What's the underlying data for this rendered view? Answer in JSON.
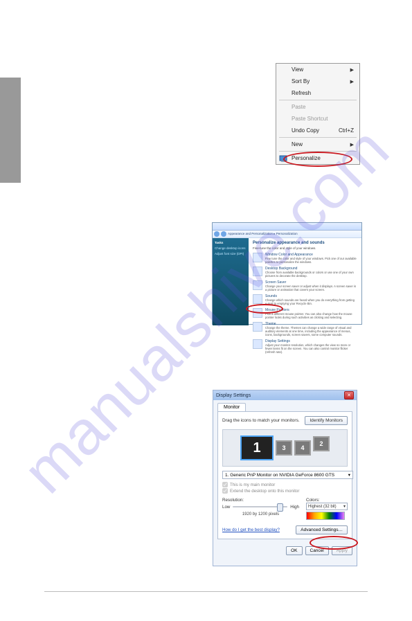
{
  "watermark": "manualshive.com",
  "context_menu": {
    "items": [
      {
        "label": "View",
        "submenu": true,
        "disabled": false,
        "name": "ctx-view"
      },
      {
        "label": "Sort By",
        "submenu": true,
        "disabled": false,
        "name": "ctx-sort-by"
      },
      {
        "label": "Refresh",
        "submenu": false,
        "disabled": false,
        "name": "ctx-refresh"
      }
    ],
    "items2": [
      {
        "label": "Paste",
        "submenu": false,
        "disabled": true,
        "name": "ctx-paste"
      },
      {
        "label": "Paste Shortcut",
        "submenu": false,
        "disabled": true,
        "name": "ctx-paste-shortcut"
      },
      {
        "label": "Undo Copy",
        "shortcut": "Ctrl+Z",
        "submenu": false,
        "disabled": false,
        "name": "ctx-undo-copy"
      }
    ],
    "items3": [
      {
        "label": "New",
        "submenu": true,
        "disabled": false,
        "name": "ctx-new"
      }
    ],
    "items4": [
      {
        "label": "Personalize",
        "submenu": false,
        "disabled": false,
        "name": "ctx-personalize",
        "icon": true
      }
    ]
  },
  "personalize_window": {
    "breadcrumb": "Appearance and Personalization  ▸  Personalization",
    "side_head": "Tasks",
    "side_items": [
      "Change desktop icons",
      "Adjust font size (DPI)"
    ],
    "main_title": "Personalize appearance and sounds",
    "main_sub": "Fine-tune the color and style of your windows.",
    "items": [
      {
        "link": "Window Color and Appearance",
        "txt": "Fine tune the color and style of your windows. Pick one of our available palettes to personalize the windows."
      },
      {
        "link": "Desktop Background",
        "txt": "Choose from available backgrounds or colors or use one of your own pictures to decorate the desktop."
      },
      {
        "link": "Screen Saver",
        "txt": "Change your screen saver or adjust when it displays. A screen saver is a picture or animation that covers your screen."
      },
      {
        "link": "Sounds",
        "txt": "Change which sounds are heard when you do everything from getting e-mail to emptying your Recycle Bin."
      },
      {
        "link": "Mouse Pointers",
        "txt": "Pick a different mouse pointer. You can also change how the mouse pointer looks during such activities as clicking and selecting."
      },
      {
        "link": "Theme",
        "txt": "Change the theme. Themes can change a wide range of visual and auditory elements at one time, including the appearance of menus, icons, backgrounds, screen savers, some computer sounds."
      },
      {
        "link": "Display Settings",
        "txt": "Adjust your monitor resolution, which changes the view so more or fewer items fit on the screen. You can also control monitor flicker (refresh rate)."
      }
    ]
  },
  "display_settings": {
    "title": "Display Settings",
    "tab": "Monitor",
    "drag_label": "Drag the icons to match your monitors.",
    "identify_btn": "Identify Monitors",
    "monitors": [
      "1",
      "3",
      "4",
      "2"
    ],
    "selected_monitor": "1. Generic PnP Monitor on NVIDIA GeForce 8600 GTS",
    "check1": "This is my main monitor",
    "check2": "Extend the desktop onto this monitor",
    "resolution_label": "Resolution:",
    "res_low": "Low",
    "res_high": "High",
    "resolution_value": "1920 by 1200 pixels",
    "colors_label": "Colors:",
    "colors_value": "Highest (32 bit)",
    "help_link": "How do I get the best display?",
    "advanced_btn": "Advanced Settings…",
    "ok": "OK",
    "cancel": "Cancel",
    "apply": "Apply"
  }
}
